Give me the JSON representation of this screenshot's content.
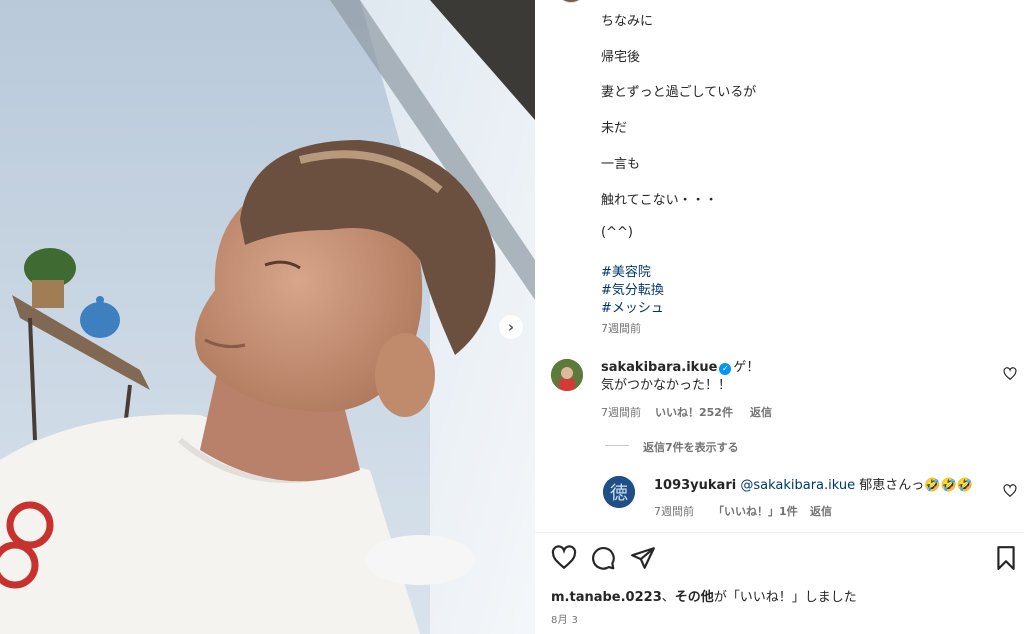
{
  "caption": {
    "lines": [
      "ちなみに",
      "帰宅後",
      "妻とずっと過ごしているが",
      "未だ",
      "一言も",
      "触れてこない・・・",
      "(^^)"
    ],
    "hashtags": [
      "#美容院",
      "#気分転換",
      "#メッシュ"
    ],
    "time_ago": "7週間前"
  },
  "comments": [
    {
      "username": "sakakibara.ikue",
      "verified": true,
      "text_line1": "ゲ！",
      "text_line2": "気がつかなかった！！",
      "time_ago": "7週間前",
      "likes_label": "いいね！252件",
      "reply_label": "返信",
      "view_replies": "返信7件を表示する"
    },
    {
      "username": "1093yukari",
      "mention": "@sakakibara.ikue",
      "text": "郁恵さんっ🤣🤣🤣",
      "time_ago": "7週間前",
      "likes_label": "「いいね！」1件",
      "reply_label": "返信"
    }
  ],
  "likes_summary": {
    "user": "m.tanabe.0223",
    "sep": "、",
    "others": "その他",
    "suffix": "が「いいね！」しました"
  },
  "date": "8月 3",
  "icons": {
    "like": "heart-icon",
    "comment": "comment-icon",
    "share": "paper-plane-icon",
    "save": "bookmark-icon",
    "next": "chevron-right-icon"
  },
  "colors": {
    "link": "#00376b",
    "meta": "#737373",
    "verified": "#0095f6"
  }
}
